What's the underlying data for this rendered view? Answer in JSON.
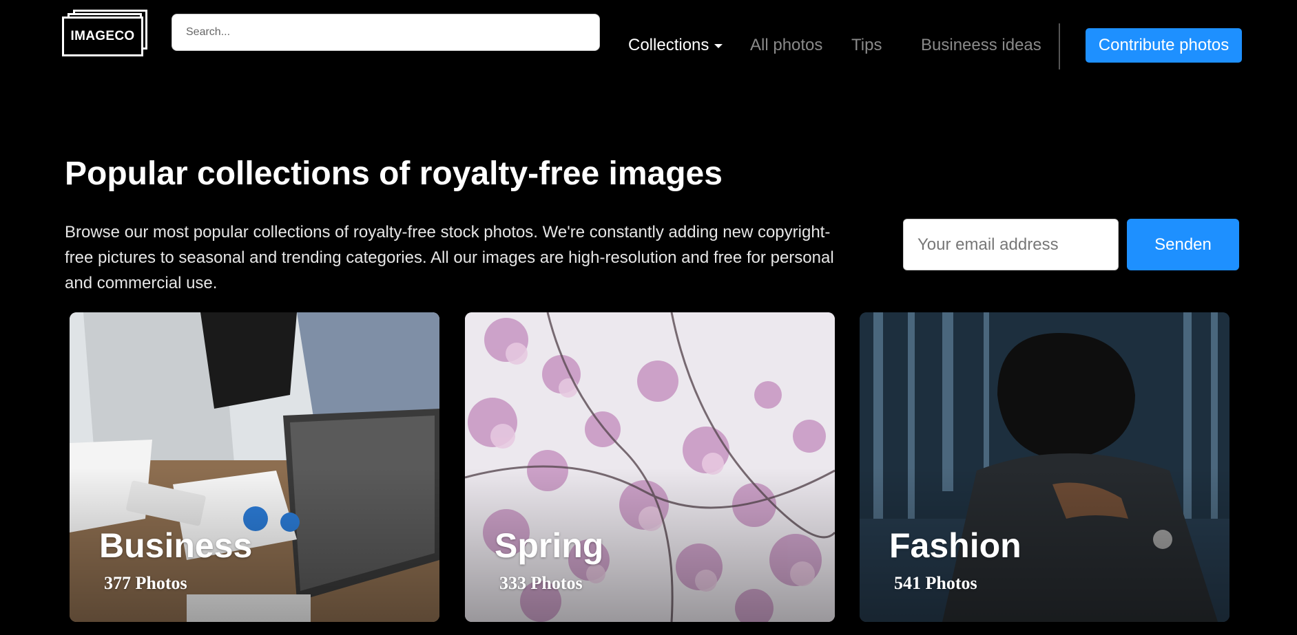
{
  "header": {
    "logo_text": "IMAGECO",
    "search_placeholder": "Search...",
    "nav": {
      "collections": "Collections",
      "all_photos": "All photos",
      "tips": "Tips",
      "business_ideas": "Busineess ideas"
    },
    "contribute_label": "Contribute photos"
  },
  "hero": {
    "title": "Popular collections of royalty-free images",
    "description": "Browse our most popular collections of royalty-free stock photos. We're constantly adding new copyright-free pictures to seasonal and trending categories. All our images are high-resolution and free for personal and commercial use."
  },
  "newsletter": {
    "email_placeholder": "Your email address",
    "submit_label": "Senden"
  },
  "collections": [
    {
      "title": "Business",
      "count": "377 Photos"
    },
    {
      "title": "Spring",
      "count": "333 Photos"
    },
    {
      "title": "Fashion",
      "count": "541 Photos"
    }
  ],
  "colors": {
    "background": "#000000",
    "accent": "#1e90ff",
    "nav_muted": "#8a8a8a"
  }
}
